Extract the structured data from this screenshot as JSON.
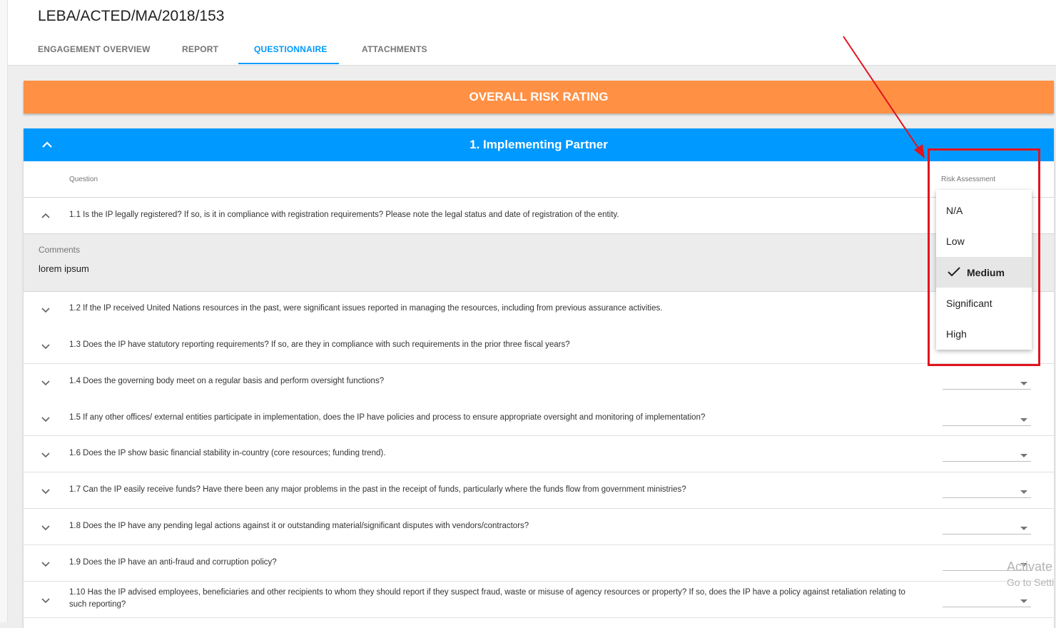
{
  "page": {
    "title": "LEBA/ACTED/MA/2018/153"
  },
  "tabs": [
    {
      "label": "ENGAGEMENT OVERVIEW",
      "active": false
    },
    {
      "label": "REPORT",
      "active": false
    },
    {
      "label": "QUESTIONNAIRE",
      "active": true
    },
    {
      "label": "ATTACHMENTS",
      "active": false
    }
  ],
  "banner": {
    "label": "OVERALL RISK RATING"
  },
  "section": {
    "title": "1. Implementing Partner",
    "column_question": "Question",
    "column_risk": "Risk Assessment",
    "comments_label": "Comments",
    "comments_value": "lorem ipsum",
    "questions": [
      "1.1 Is the IP legally registered? If so, is it in compliance with registration requirements? Please note the legal status and date of registration of the entity.",
      "1.2 If the IP received United Nations resources in the past, were significant issues reported in managing the resources, including from previous assurance activities.",
      "1.3 Does the IP have statutory reporting requirements? If so, are they in compliance with such requirements in the prior three fiscal years?",
      "1.4 Does the governing body meet on a regular basis and perform oversight functions?",
      "1.5 If any other offices/ external entities participate in implementation, does the IP have policies and process to ensure appropriate oversight and monitoring of implementation?",
      "1.6 Does the IP show basic financial stability in-country (core resources; funding trend).",
      "1.7 Can the IP easily receive funds? Have there been any major problems in the past in the receipt of funds, particularly where the funds flow from government ministries?",
      "1.8 Does the IP have any pending legal actions against it or outstanding material/significant disputes with vendors/contractors?",
      "1.9 Does the IP have an anti-fraud and corruption policy?",
      "1.10 Has the IP advised employees, beneficiaries and other recipients to whom they should report if they suspect fraud, waste or misuse of agency resources or property? If so, does the IP have a policy against retaliation relating to such reporting?"
    ]
  },
  "dropdown": {
    "options": [
      "N/A",
      "Low",
      "Medium",
      "Significant",
      "High"
    ],
    "selected": "Medium"
  },
  "watermark": {
    "line1": "Activate",
    "line2": "Go to Setti"
  },
  "colors": {
    "accent": "#0099ff",
    "banner": "#ff9044",
    "highlight": "#e0141e"
  }
}
